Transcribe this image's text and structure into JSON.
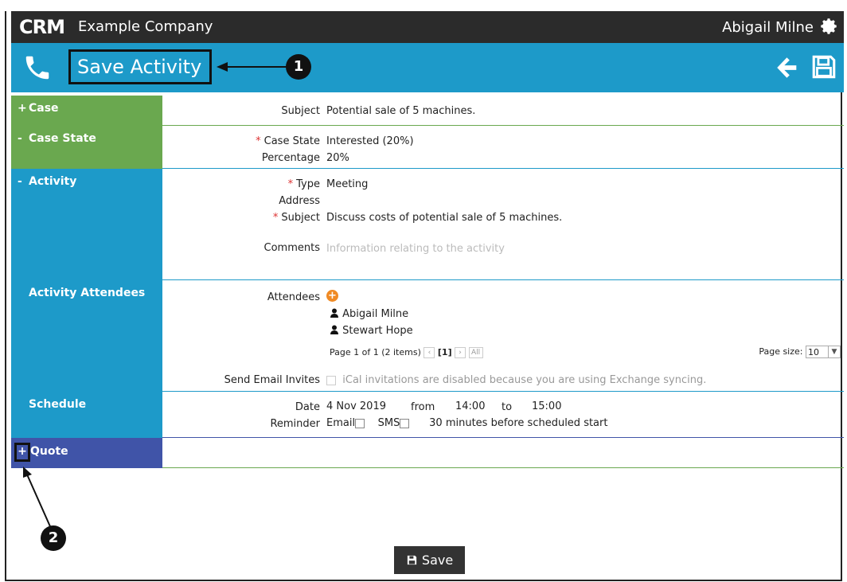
{
  "app": {
    "logo": "CRM",
    "company": "Example Company",
    "user": "Abigail Milne"
  },
  "header": {
    "title": "Save Activity"
  },
  "callouts": {
    "one": "1",
    "two": "2"
  },
  "sections": {
    "case": {
      "sign": "+",
      "title": "Case",
      "subject_label": "Subject",
      "subject_value": "Potential sale of 5 machines."
    },
    "case_state": {
      "sign": "-",
      "title": "Case State",
      "state_label": "Case State",
      "state_value": "Interested (20%)",
      "percentage_label": "Percentage",
      "percentage_value": "20%"
    },
    "activity": {
      "sign": "-",
      "title": "Activity",
      "type_label": "Type",
      "type_value": "Meeting",
      "address_label": "Address",
      "subject_label": "Subject",
      "subject_value": "Discuss costs of potential sale of 5 machines.",
      "comments_label": "Comments",
      "comments_placeholder": "Information relating to the activity"
    },
    "attendees": {
      "title": "Activity Attendees",
      "label": "Attendees",
      "add": "+",
      "people": [
        "Abigail Milne",
        "Stewart Hope"
      ],
      "pager_text": "Page 1 of 1 (2 items)",
      "current_page": "[1]",
      "page_size_label": "Page size:",
      "page_size_value": "10",
      "email_label": "Send Email Invites",
      "email_note": "iCal invitations are disabled because you are using Exchange syncing."
    },
    "schedule": {
      "title": "Schedule",
      "date_label": "Date",
      "date_value": "4 Nov 2019",
      "from_label": "from",
      "from_value": "14:00",
      "to_label": "to",
      "to_value": "15:00",
      "reminder_label": "Reminder",
      "email_opt": "Email",
      "sms_opt": "SMS",
      "minutes": "30 minutes",
      "before": "before scheduled start"
    },
    "quote": {
      "sign": "+",
      "title": "Quote"
    }
  },
  "footer": {
    "save_label": "Save"
  },
  "colors": {
    "header_dark": "#2b2b2b",
    "accent_blue": "#1d9ac9",
    "green": "#6aa84f",
    "purple": "#4054a8",
    "orange": "#f08a24"
  }
}
